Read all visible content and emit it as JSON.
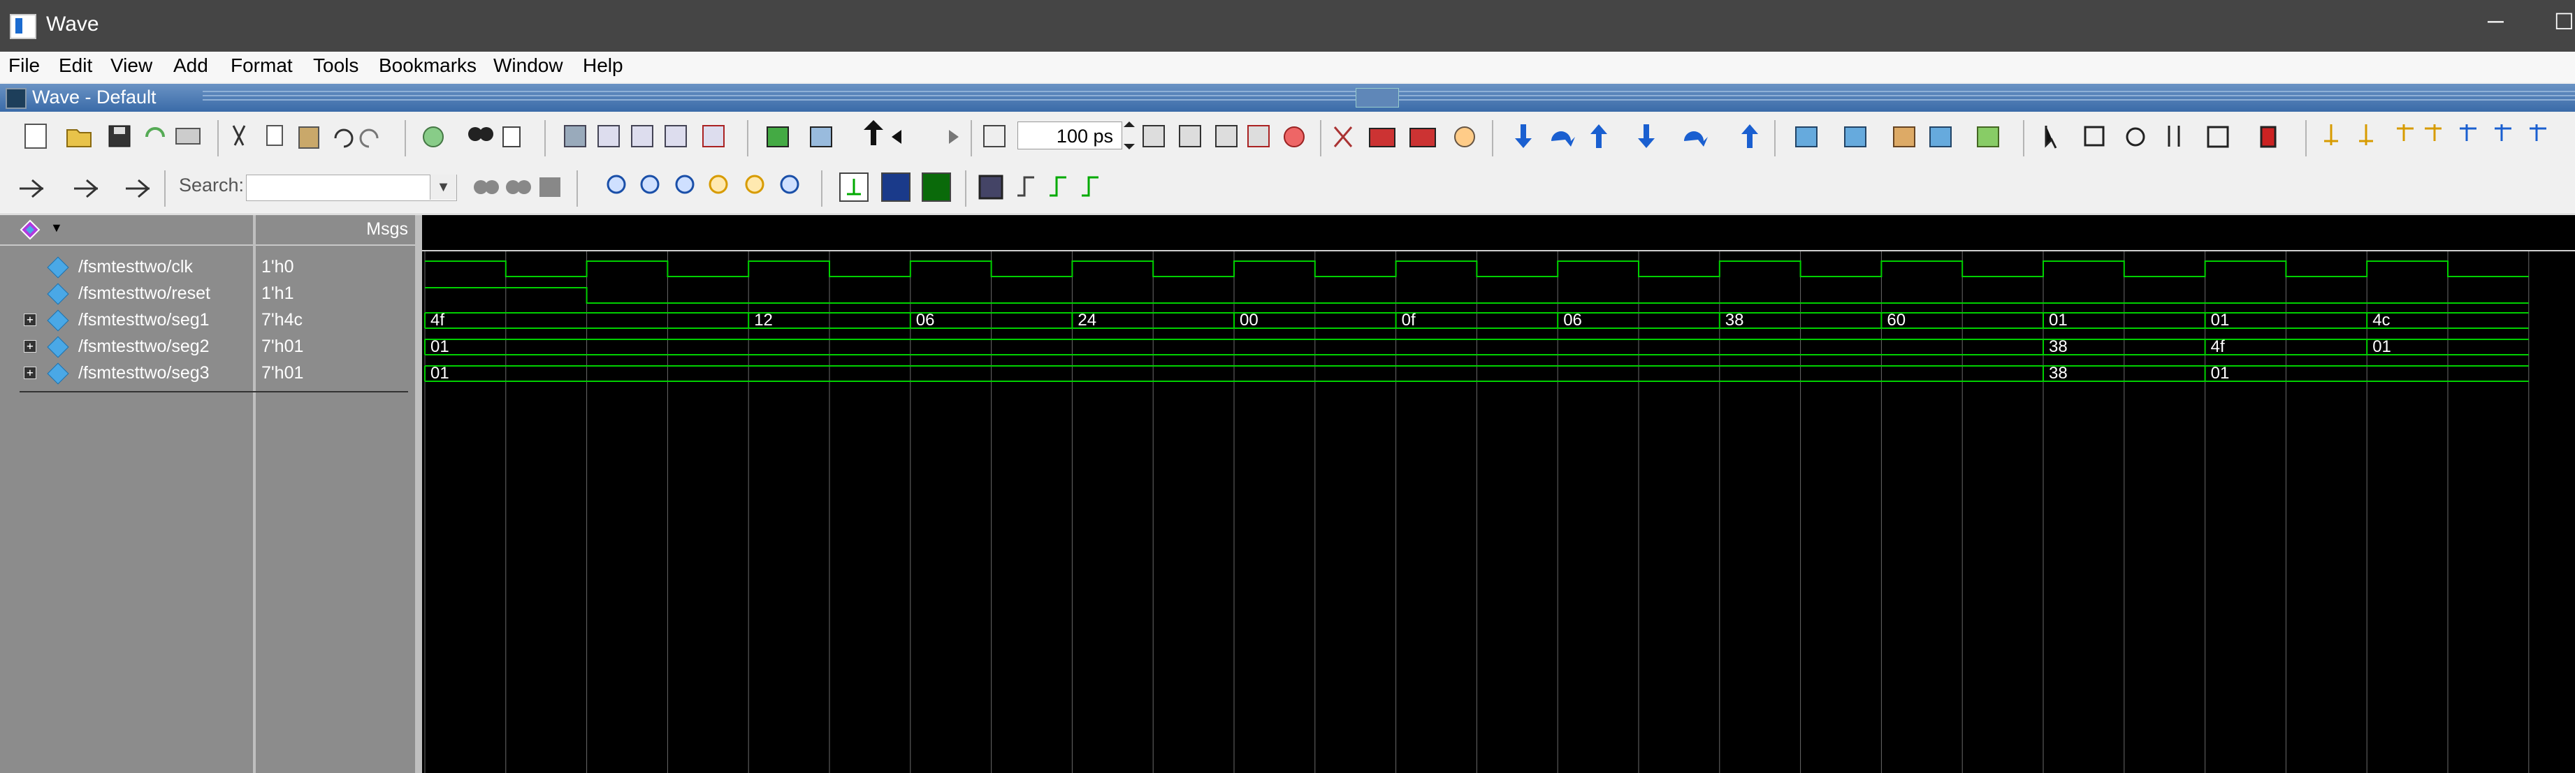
{
  "window": {
    "title": "Wave",
    "minimize_label": "─",
    "maximize_label": "☐"
  },
  "menu": [
    "File",
    "Edit",
    "View",
    "Add",
    "Format",
    "Tools",
    "Bookmarks",
    "Window",
    "Help"
  ],
  "subwindow": {
    "title": "Wave - Default"
  },
  "toolbar": {
    "zoom_value": "100 ps",
    "search_label": "Search:",
    "search_value": ""
  },
  "columns": {
    "values_header": "Msgs"
  },
  "signals": [
    {
      "name": "/fsmtesttwo/clk",
      "value": "1'h0",
      "expandable": false
    },
    {
      "name": "/fsmtesttwo/reset",
      "value": "1'h1",
      "expandable": false
    },
    {
      "name": "/fsmtesttwo/seg1",
      "value": "7'h4c",
      "expandable": true
    },
    {
      "name": "/fsmtesttwo/seg2",
      "value": "7'h01",
      "expandable": true
    },
    {
      "name": "/fsmtesttwo/seg3",
      "value": "7'h01",
      "expandable": true
    }
  ],
  "waves": {
    "clk_period_cols": 2,
    "reset_release_col": 2,
    "seg1": [
      {
        "start": 0,
        "label": "4f"
      },
      {
        "start": 4,
        "label": "12"
      },
      {
        "start": 6,
        "label": "06"
      },
      {
        "start": 8,
        "label": "24"
      },
      {
        "start": 10,
        "label": "00"
      },
      {
        "start": 12,
        "label": "0f"
      },
      {
        "start": 14,
        "label": "06"
      },
      {
        "start": 16,
        "label": "38"
      },
      {
        "start": 18,
        "label": "60"
      },
      {
        "start": 20,
        "label": "01"
      },
      {
        "start": 22,
        "label": "01"
      },
      {
        "start": 24,
        "label": "4c"
      }
    ],
    "seg2": [
      {
        "start": 0,
        "label": "01"
      },
      {
        "start": 20,
        "label": "38"
      },
      {
        "start": 22,
        "label": "4f"
      },
      {
        "start": 24,
        "label": "01"
      }
    ],
    "seg3": [
      {
        "start": 0,
        "label": "01"
      },
      {
        "start": 20,
        "label": "38"
      },
      {
        "start": 22,
        "label": "01"
      }
    ],
    "trace_color": "#00d000",
    "grid_color": "#6a6a6a"
  }
}
